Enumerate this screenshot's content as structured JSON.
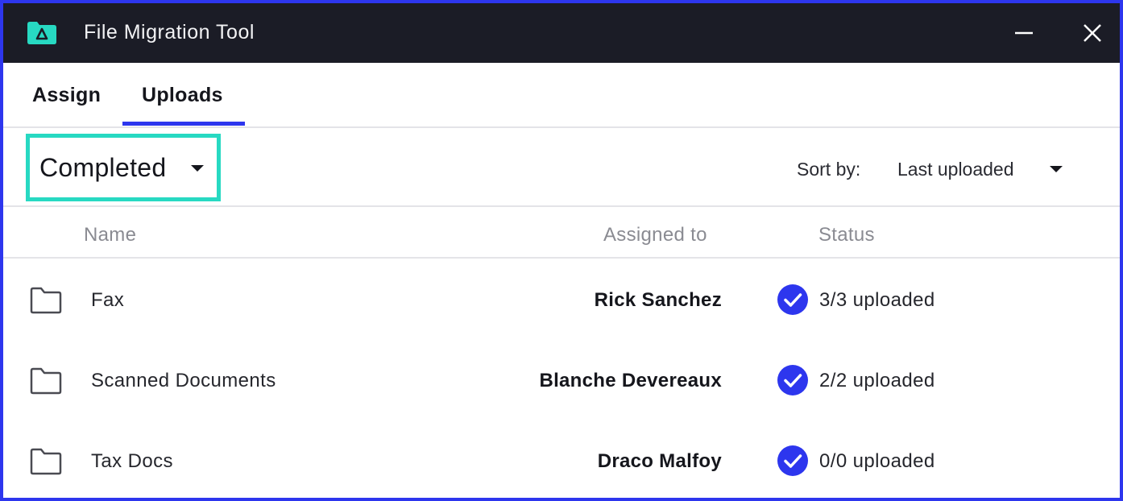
{
  "app": {
    "title": "File Migration Tool",
    "logo_icon": "delta-folder-icon",
    "accent_color": "#2d36ee",
    "highlight_color": "#27d9c2"
  },
  "tabs": [
    {
      "label": "Assign",
      "active": false
    },
    {
      "label": "Uploads",
      "active": true
    }
  ],
  "filter": {
    "selected": "Completed"
  },
  "sort": {
    "label": "Sort by:",
    "selected": "Last uploaded"
  },
  "table": {
    "columns": [
      "Name",
      "Assigned to",
      "Status"
    ],
    "rows": [
      {
        "name": "Fax",
        "assigned_to": "Rick Sanchez",
        "status": "3/3 uploaded",
        "icon": "folder-icon",
        "status_icon": "check-circle-icon"
      },
      {
        "name": "Scanned Documents",
        "assigned_to": "Blanche Devereaux",
        "status": "2/2 uploaded",
        "icon": "folder-icon",
        "status_icon": "check-circle-icon"
      },
      {
        "name": "Tax Docs",
        "assigned_to": "Draco Malfoy",
        "status": "0/0 uploaded",
        "icon": "folder-icon",
        "status_icon": "check-circle-icon"
      }
    ]
  }
}
